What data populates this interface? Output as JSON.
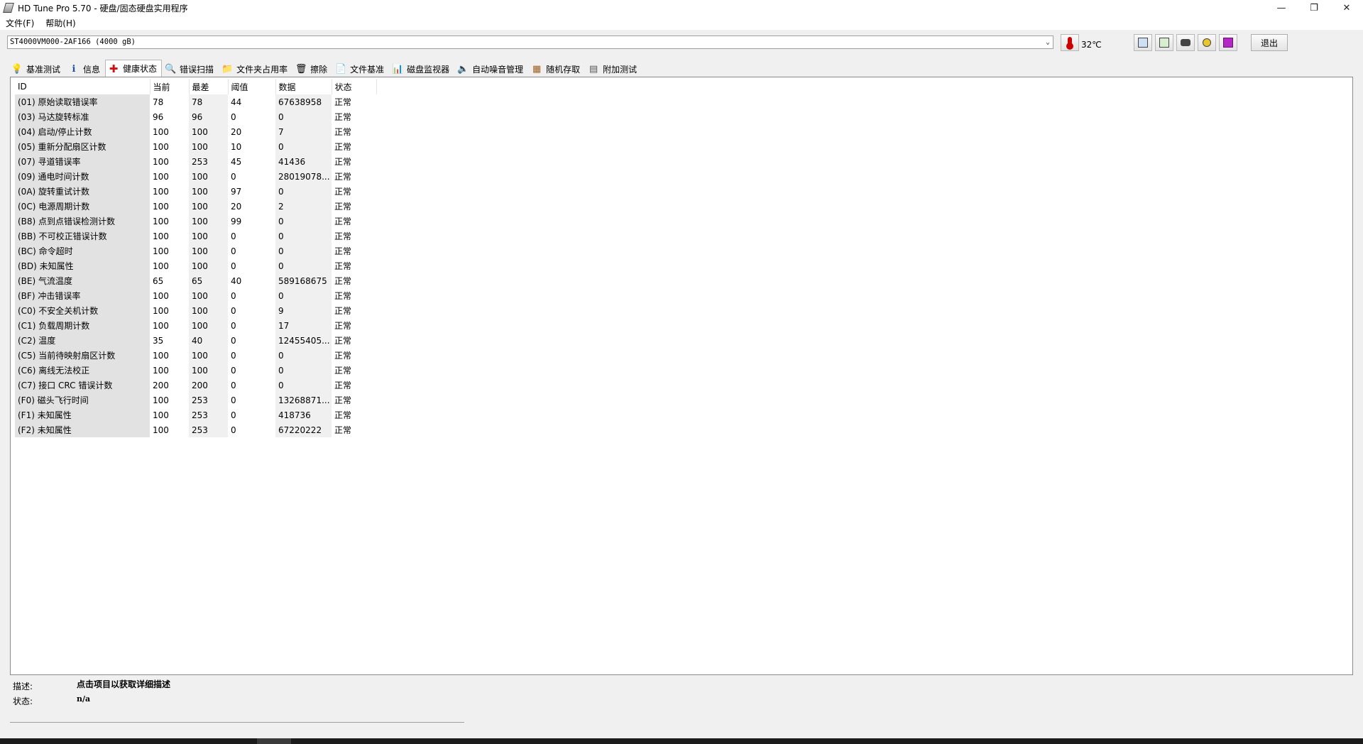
{
  "window": {
    "title": "HD Tune Pro 5.70 - 硬盘/固态硬盘实用程序",
    "min": "—",
    "restore": "❐",
    "close": "✕"
  },
  "menu": [
    {
      "label": "文件(F)"
    },
    {
      "label": "帮助(H)"
    }
  ],
  "drive": {
    "selected": "ST4000VM000-2AF166 (4000 gB)",
    "temperature": "32℃",
    "exit_label": "退出"
  },
  "tabs": [
    {
      "label": "基准测试",
      "icon": "bulb-icon",
      "glyph": "💡"
    },
    {
      "label": "信息",
      "icon": "info-icon",
      "glyph": "ℹ"
    },
    {
      "label": "健康状态",
      "icon": "health-cross-icon",
      "glyph": "✚"
    },
    {
      "label": "错误扫描",
      "icon": "magnifier-icon",
      "glyph": "🔍"
    },
    {
      "label": "文件夹占用率",
      "icon": "folder-icon",
      "glyph": "📁"
    },
    {
      "label": "擦除",
      "icon": "trash-icon",
      "glyph": "🗑"
    },
    {
      "label": "文件基准",
      "icon": "file-benchmark-icon",
      "glyph": "📄"
    },
    {
      "label": "磁盘监视器",
      "icon": "monitor-chart-icon",
      "glyph": "📊"
    },
    {
      "label": "自动噪音管理",
      "icon": "speaker-icon",
      "glyph": "🔈"
    },
    {
      "label": "随机存取",
      "icon": "random-access-icon",
      "glyph": "▦"
    },
    {
      "label": "附加测试",
      "icon": "extra-tests-icon",
      "glyph": "▤"
    }
  ],
  "table": {
    "headers": [
      "ID",
      "当前",
      "最差",
      "阈值",
      "数据",
      "状态"
    ],
    "rows": [
      [
        "(01) 原始读取错误率",
        "78",
        "78",
        "44",
        "67638958",
        "正常"
      ],
      [
        "(03) 马达旋转标准",
        "96",
        "96",
        "0",
        "0",
        "正常"
      ],
      [
        "(04) 启动/停止计数",
        "100",
        "100",
        "20",
        "7",
        "正常"
      ],
      [
        "(05) 重新分配扇区计数",
        "100",
        "100",
        "10",
        "0",
        "正常"
      ],
      [
        "(07) 寻道错误率",
        "100",
        "253",
        "45",
        "41436",
        "正常"
      ],
      [
        "(09) 通电时间计数",
        "100",
        "100",
        "0",
        "28019078...",
        "正常"
      ],
      [
        "(0A) 旋转重试计数",
        "100",
        "100",
        "97",
        "0",
        "正常"
      ],
      [
        "(0C) 电源周期计数",
        "100",
        "100",
        "20",
        "2",
        "正常"
      ],
      [
        "(B8) 点到点错误检测计数",
        "100",
        "100",
        "99",
        "0",
        "正常"
      ],
      [
        "(BB) 不可校正错误计数",
        "100",
        "100",
        "0",
        "0",
        "正常"
      ],
      [
        "(BC) 命令超时",
        "100",
        "100",
        "0",
        "0",
        "正常"
      ],
      [
        "(BD) 未知属性",
        "100",
        "100",
        "0",
        "0",
        "正常"
      ],
      [
        "(BE) 气流温度",
        "65",
        "65",
        "40",
        "589168675",
        "正常"
      ],
      [
        "(BF) 冲击错误率",
        "100",
        "100",
        "0",
        "0",
        "正常"
      ],
      [
        "(C0) 不安全关机计数",
        "100",
        "100",
        "0",
        "9",
        "正常"
      ],
      [
        "(C1) 负载周期计数",
        "100",
        "100",
        "0",
        "17",
        "正常"
      ],
      [
        "(C2) 温度",
        "35",
        "40",
        "0",
        "12455405...",
        "正常"
      ],
      [
        "(C5) 当前待映射扇区计数",
        "100",
        "100",
        "0",
        "0",
        "正常"
      ],
      [
        "(C6) 离线无法校正",
        "100",
        "100",
        "0",
        "0",
        "正常"
      ],
      [
        "(C7) 接口 CRC 错误计数",
        "200",
        "200",
        "0",
        "0",
        "正常"
      ],
      [
        "(F0) 磁头飞行时间",
        "100",
        "253",
        "0",
        "13268871...",
        "正常"
      ],
      [
        "(F1) 未知属性",
        "100",
        "253",
        "0",
        "418736",
        "正常"
      ],
      [
        "(F2) 未知属性",
        "100",
        "253",
        "0",
        "67220222",
        "正常"
      ]
    ]
  },
  "description": {
    "label": "描述:",
    "value": "点击项目以获取详细描述"
  },
  "status": {
    "label": "状态:",
    "value": "n/a"
  }
}
